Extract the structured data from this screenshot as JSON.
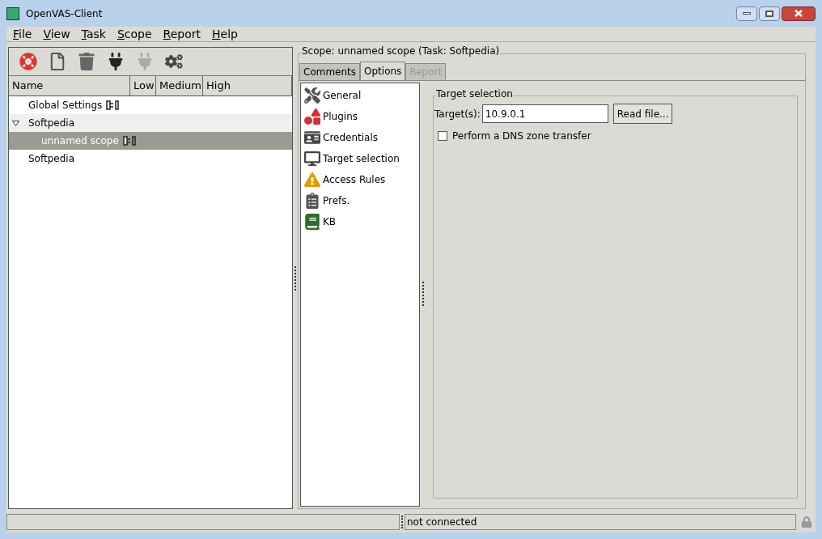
{
  "window": {
    "title": "OpenVAS-Client"
  },
  "menu": [
    "File",
    "View",
    "Task",
    "Scope",
    "Report",
    "Help"
  ],
  "tree": {
    "columns": [
      "Name",
      "Low",
      "Medium",
      "High"
    ],
    "items": [
      {
        "label": "Global Settings",
        "connected": false,
        "selected": false
      },
      {
        "label": "Softpedia",
        "selected": false,
        "expanded": true,
        "children": [
          {
            "label": "unnamed scope",
            "connected": false,
            "selected": true
          }
        ]
      },
      {
        "label": "Softpedia",
        "selected": false
      }
    ]
  },
  "scope_frame": {
    "title": "Scope: unnamed scope (Task: Softpedia)"
  },
  "tabs": [
    {
      "label": "Comments",
      "selected": false,
      "disabled": false
    },
    {
      "label": "Options",
      "selected": true,
      "disabled": false
    },
    {
      "label": "Report",
      "selected": false,
      "disabled": true
    }
  ],
  "options": [
    {
      "label": "General",
      "kind": "general"
    },
    {
      "label": "Plugins",
      "kind": "plugins"
    },
    {
      "label": "Credentials",
      "kind": "credentials"
    },
    {
      "label": "Target selection",
      "kind": "targets"
    },
    {
      "label": "Access Rules",
      "kind": "access"
    },
    {
      "label": "Prefs.",
      "kind": "prefs"
    },
    {
      "label": "KB",
      "kind": "kb"
    }
  ],
  "target_selection": {
    "title": "Target selection",
    "targets_label": "Target(s):",
    "targets_value": "10.9.0.1",
    "read_file": "Read file...",
    "dns_transfer": {
      "label": "Perform a DNS zone transfer",
      "checked": false
    }
  },
  "status_bar": {
    "text": "not connected"
  }
}
